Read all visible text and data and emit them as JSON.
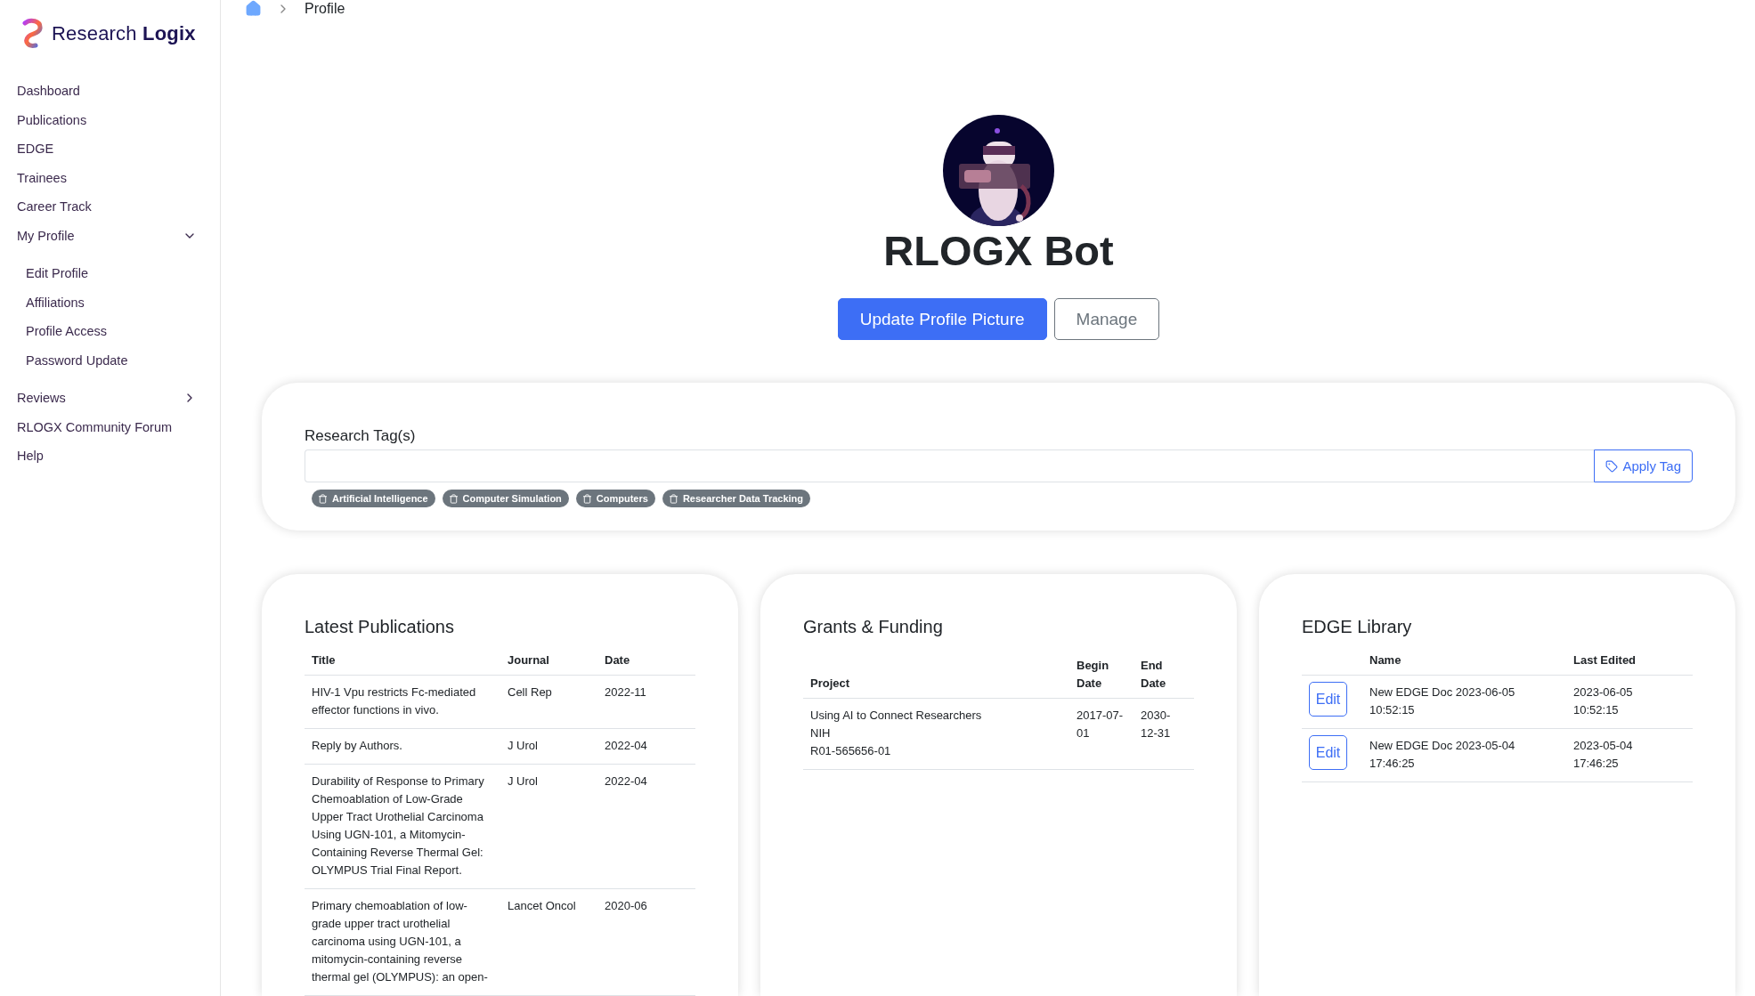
{
  "brand": {
    "name": "Research **Logix**"
  },
  "sidebar": {
    "items": [
      {
        "label": "Dashboard"
      },
      {
        "label": "Publications"
      },
      {
        "label": "EDGE"
      },
      {
        "label": "Trainees"
      },
      {
        "label": "Career Track"
      },
      {
        "label": "My Profile",
        "expanded": true,
        "children": [
          {
            "label": "Edit Profile"
          },
          {
            "label": "Affiliations"
          },
          {
            "label": "Profile Access"
          },
          {
            "label": "Password Update"
          }
        ]
      },
      {
        "label": "Reviews",
        "expanded": false
      },
      {
        "label": "RLOGX Community Forum"
      },
      {
        "label": "Help"
      }
    ]
  },
  "breadcrumb": {
    "current": "Profile"
  },
  "profile": {
    "name": "RLOGX Bot",
    "buttons": [
      {
        "label": "Update Profile Picture",
        "kind": "primary"
      },
      {
        "label": "Manage",
        "kind": "secondary"
      }
    ]
  },
  "research_tags": {
    "label": "Research Tag(s)",
    "button": "Apply Tag",
    "tags": [
      "Artificial Intelligence",
      "Computer Simulation",
      "Computers",
      "Researcher Data Tracking"
    ]
  },
  "latest_publications": {
    "title": "Latest Publications",
    "columns": [
      "Title",
      "Journal",
      "Date"
    ],
    "rows": [
      [
        "HIV-1 Vpu restricts Fc-mediated effector functions in vivo.",
        "Cell Rep",
        "2022-11"
      ],
      [
        "Reply by Authors.",
        "J Urol",
        "2022-04"
      ],
      [
        "Durability of Response to Primary Chemoablation of Low-Grade Upper Tract Urothelial Carcinoma Using UGN-101, a Mitomycin-Containing Reverse Thermal Gel: OLYMPUS Trial Final Report.",
        "J Urol",
        "2022-04"
      ],
      [
        "Primary chemoablation of low-grade upper tract urothelial carcinoma using UGN-101, a mitomycin-containing reverse thermal gel (OLYMPUS): an open-",
        "Lancet Oncol",
        "2020-06"
      ]
    ]
  },
  "grants": {
    "title": "Grants & Funding",
    "columns": [
      "Project",
      "Begin Date",
      "End Date"
    ],
    "rows": [
      {
        "project": [
          "Using AI to Connect Researchers",
          "NIH",
          "R01-565656-01"
        ],
        "begin": "2017-07-01",
        "end": "2030-12-31"
      }
    ]
  },
  "edge_library": {
    "title": "EDGE Library",
    "columns": [
      "Name",
      "Last Edited"
    ],
    "rows": [
      {
        "action": "Edit",
        "name": "New EDGE Doc 2023-06-05 10:52:15",
        "last_edited": "2023-06-05 10:52:15"
      },
      {
        "action": "Edit",
        "name": "New EDGE Doc 2023-05-04 17:46:25",
        "last_edited": "2023-05-04 17:46:25"
      }
    ]
  }
}
